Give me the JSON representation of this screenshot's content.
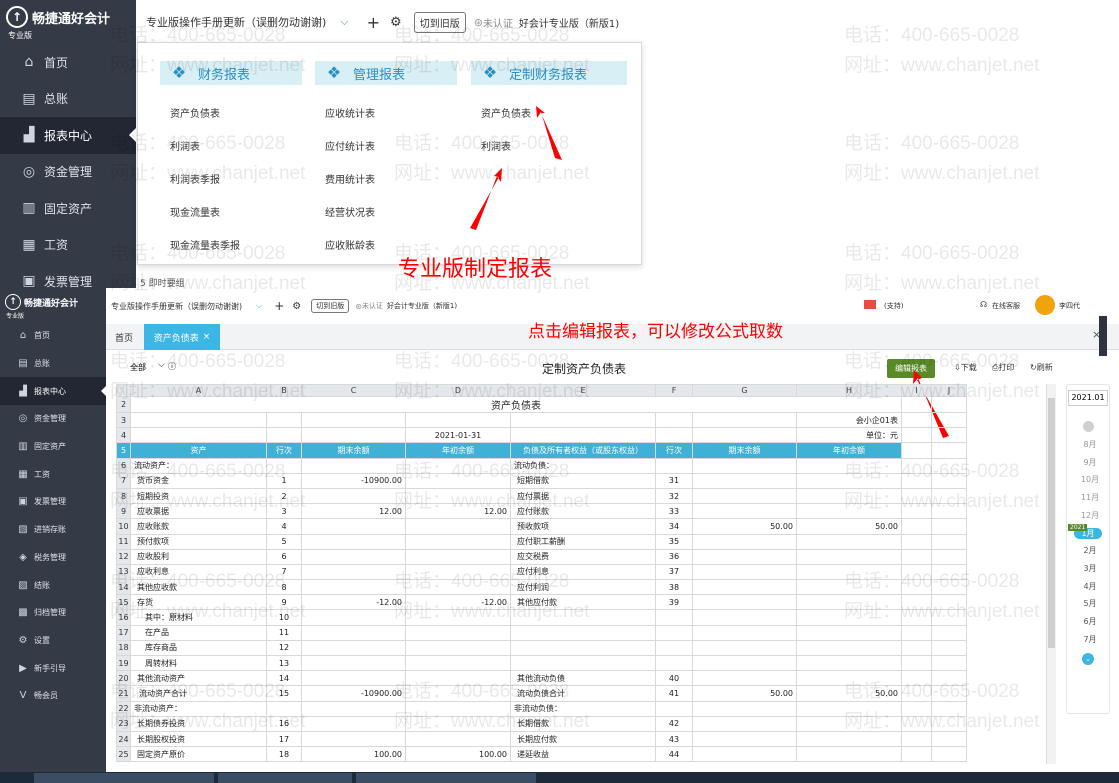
{
  "top": {
    "brand": "畅捷通好会计",
    "edition": "专业版",
    "sidebar": [
      {
        "label": "首页",
        "icon": "home-icon",
        "glyph": "⌂"
      },
      {
        "label": "总账",
        "icon": "ledger-icon",
        "glyph": "▤"
      },
      {
        "label": "报表中心",
        "icon": "report-icon",
        "glyph": "▟",
        "active": true
      },
      {
        "label": "资金管理",
        "icon": "fund-icon",
        "glyph": "◎"
      },
      {
        "label": "固定资产",
        "icon": "asset-icon",
        "glyph": "▥"
      },
      {
        "label": "工资",
        "icon": "salary-icon",
        "glyph": "▦"
      },
      {
        "label": "发票管理",
        "icon": "invoice-icon",
        "glyph": "▣"
      }
    ],
    "notice": "专业版操作手册更新（误删勿动谢谢)",
    "switch_old": "切到旧版",
    "cert": "未认证",
    "product": "好会计专业版（新版1)",
    "categories": [
      {
        "label": "财务报表",
        "items": [
          "资产负债表",
          "利润表",
          "利润表季报",
          "现金流量表",
          "现金流量表季报"
        ]
      },
      {
        "label": "管理报表",
        "items": [
          "应收统计表",
          "应付统计表",
          "费用统计表",
          "经营状况表",
          "应收账龄表"
        ]
      },
      {
        "label": "定制财务报表",
        "items": [
          "资产负债表",
          "利润表"
        ]
      }
    ],
    "behind_text": "5  即时要组",
    "annotation": "专业版制定报表"
  },
  "bottom": {
    "brand": "畅捷通好会计",
    "edition": "专业版",
    "sidebar": [
      {
        "label": "首页",
        "glyph": "⌂",
        "icon": "home-icon"
      },
      {
        "label": "总账",
        "glyph": "▤",
        "icon": "ledger-icon"
      },
      {
        "label": "报表中心",
        "glyph": "▟",
        "icon": "report-icon",
        "active": true
      },
      {
        "label": "资金管理",
        "glyph": "◎",
        "icon": "fund-icon"
      },
      {
        "label": "固定资产",
        "glyph": "▥",
        "icon": "asset-icon"
      },
      {
        "label": "工资",
        "glyph": "▦",
        "icon": "salary-icon"
      },
      {
        "label": "发票管理",
        "glyph": "▣",
        "icon": "invoice-icon"
      },
      {
        "label": "进销存账",
        "glyph": "▧",
        "icon": "inventory-icon"
      },
      {
        "label": "税务管理",
        "glyph": "◈",
        "icon": "tax-icon"
      },
      {
        "label": "结账",
        "glyph": "▨",
        "icon": "closing-icon"
      },
      {
        "label": "归档管理",
        "glyph": "▩",
        "icon": "archive-icon"
      },
      {
        "label": "设置",
        "glyph": "⚙",
        "icon": "settings-icon"
      },
      {
        "label": "新手引导",
        "glyph": "▶",
        "icon": "guide-icon"
      },
      {
        "label": "畅会员",
        "glyph": "V",
        "icon": "vip-icon"
      }
    ],
    "notice": "专业版操作手册更新（误删勿动谢谢)",
    "switch_old": "切到旧版",
    "cert": "未认证",
    "product": "好会计专业版（新版1)",
    "support_label": "(支持)",
    "service_label": "在线客服",
    "user": "李四代",
    "tabs": [
      "首页",
      "资产负债表"
    ],
    "tab_close": "×",
    "filter": "全部",
    "title": "定制资产负债表",
    "edit_btn": "编辑报表",
    "download": "下载",
    "print": "打印",
    "refresh": "刷新",
    "annotation": "点击编辑报表，可以修改公式取数",
    "year_box": "2021.01",
    "badge_year": "2021",
    "months": [
      {
        "label": "8月",
        "color": "#999999"
      },
      {
        "label": "9月",
        "color": "#999999"
      },
      {
        "label": "10月",
        "color": "#999999"
      },
      {
        "label": "11月",
        "color": "#999999"
      },
      {
        "label": "12月",
        "color": "#999999"
      },
      {
        "label": "1月",
        "color": "#ffffff"
      },
      {
        "label": "2月",
        "color": "#555555"
      },
      {
        "label": "3月",
        "color": "#555555"
      },
      {
        "label": "4月",
        "color": "#555555"
      },
      {
        "label": "5月",
        "color": "#555555"
      },
      {
        "label": "6月",
        "color": "#555555"
      },
      {
        "label": "7月",
        "color": "#555555"
      }
    ],
    "sheet": {
      "col_letters": [
        "A",
        "B",
        "C",
        "D",
        "E",
        "F",
        "G",
        "H",
        "I",
        "J"
      ],
      "report_title": "资产负债表",
      "form_no": "会小企01表",
      "date": "2021-01-31",
      "unit": "单位：元",
      "headers": [
        "资产",
        "行次",
        "期末余额",
        "年初余额",
        "负债及所有者权益（或股东权益）",
        "行次",
        "期末余额",
        "年初余额"
      ],
      "rows": [
        [
          "流动资产：",
          "",
          "",
          "",
          "流动负债：",
          "",
          "",
          ""
        ],
        [
          "货币资金",
          "1",
          "-10900.00",
          "",
          "短期借款",
          "31",
          "",
          ""
        ],
        [
          "短期投资",
          "2",
          "",
          "",
          "应付票据",
          "32",
          "",
          ""
        ],
        [
          "应收票据",
          "3",
          "12.00",
          "12.00",
          "应付账款",
          "33",
          "",
          ""
        ],
        [
          "应收账款",
          "4",
          "",
          "",
          "预收款项",
          "34",
          "50.00",
          "50.00"
        ],
        [
          "预付款项",
          "5",
          "",
          "",
          "应付职工薪酬",
          "35",
          "",
          ""
        ],
        [
          "应收股利",
          "6",
          "",
          "",
          "应交税费",
          "36",
          "",
          ""
        ],
        [
          "应收利息",
          "7",
          "",
          "",
          "应付利息",
          "37",
          "",
          ""
        ],
        [
          "其他应收款",
          "8",
          "",
          "",
          "应付利润",
          "38",
          "",
          ""
        ],
        [
          "存货",
          "9",
          "-12.00",
          "-12.00",
          "其他应付款",
          "39",
          "",
          ""
        ],
        [
          "其中：原材料",
          "10",
          "",
          "",
          "",
          "",
          "",
          ""
        ],
        [
          "在产品",
          "11",
          "",
          "",
          "",
          "",
          "",
          ""
        ],
        [
          "库存商品",
          "12",
          "",
          "",
          "",
          "",
          "",
          ""
        ],
        [
          "周转材料",
          "13",
          "",
          "",
          "",
          "",
          "",
          ""
        ],
        [
          "其他流动资产",
          "14",
          "",
          "",
          "其他流动负债",
          "40",
          "",
          ""
        ],
        [
          "流动资产合计",
          "15",
          "-10900.00",
          "",
          "流动负债合计",
          "41",
          "50.00",
          "50.00"
        ],
        [
          "非流动资产：",
          "",
          "",
          "",
          "非流动负债：",
          "",
          "",
          ""
        ],
        [
          "长期债券投资",
          "16",
          "",
          "",
          "长期借款",
          "42",
          "",
          ""
        ],
        [
          "长期股权投资",
          "17",
          "",
          "",
          "长期应付款",
          "43",
          "",
          ""
        ],
        [
          "固定资产原价",
          "18",
          "100.00",
          "100.00",
          "递延收益",
          "44",
          "",
          ""
        ]
      ]
    }
  },
  "watermark": {
    "phone": "电话：400-665-0028",
    "site": "网址：www.chanjet.net"
  },
  "colors": {
    "sidebar": "#343a46",
    "accent_blue": "#2a8fc4",
    "header_cyan": "#3fb0d6",
    "tab_cyan": "#3cb6e3",
    "edit_green": "#5a8a27",
    "annotation_red": "#ff0000"
  }
}
